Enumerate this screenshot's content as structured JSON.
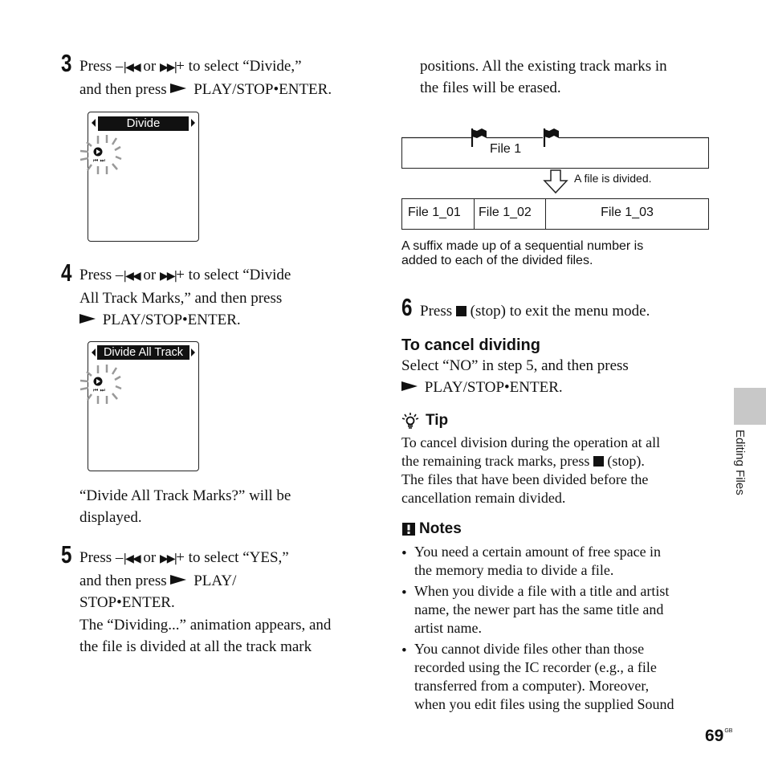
{
  "steps": {
    "s3": {
      "number": "3",
      "lines": [
        "Press –",
        " or ",
        "+ to select “Divide,”",
        "and then press ",
        " PLAY/STOP•ENTER."
      ],
      "display_label": "Divide"
    },
    "s4": {
      "number": "4",
      "lines": [
        "Press –",
        " or ",
        "+ to select “Divide",
        "All Track Marks,” and then press",
        " PLAY/STOP•ENTER."
      ],
      "display_label": "Divide All Track",
      "after": [
        "“Divide All Track Marks?” will be",
        "displayed."
      ]
    },
    "s5": {
      "number": "5",
      "lines": [
        "Press –",
        " or ",
        "+ to select “YES,”",
        "and then press ",
        " PLAY/",
        "STOP•ENTER."
      ],
      "after": [
        "The “Dividing...” animation appears, and",
        "the file is divided at all the track mark",
        "positions. All the existing track marks in",
        "the files will be erased."
      ]
    },
    "s6": {
      "number": "6",
      "pre": "Press ",
      "post": " (stop) to exit the menu mode."
    }
  },
  "icons": {
    "prev": "|◀◀",
    "next": "▶▶|"
  },
  "diagram": {
    "source_file": "File 1",
    "arrow_caption": "A file is divided.",
    "result_files": [
      "File 1_01",
      "File 1_02",
      "File 1_03"
    ],
    "caption": [
      "A suffix made up of a sequential number is",
      "added to each of the divided files."
    ]
  },
  "cancel": {
    "heading": "To cancel dividing",
    "lines": [
      "Select “NO” in step 5, and then press",
      " PLAY/STOP•ENTER."
    ]
  },
  "tip": {
    "heading": "Tip",
    "lines": [
      "To cancel division during the operation at all",
      "the remaining track marks, press ",
      " (stop).",
      "The files that have been divided before the",
      "cancellation remain divided."
    ]
  },
  "notes": {
    "heading": "Notes",
    "items": [
      [
        "You need a certain amount of free space in",
        "the memory media to divide a file."
      ],
      [
        "When you divide a file with a title and artist",
        "name, the newer part has the same title and",
        "artist name."
      ],
      [
        "You cannot divide files other than those",
        "recorded using the IC recorder (e.g., a file",
        "transferred from a computer). Moreover,",
        "when you edit files using the supplied Sound"
      ]
    ]
  },
  "side_tab": "Editing Files",
  "page": {
    "number": "69",
    "suffix": "GB"
  }
}
